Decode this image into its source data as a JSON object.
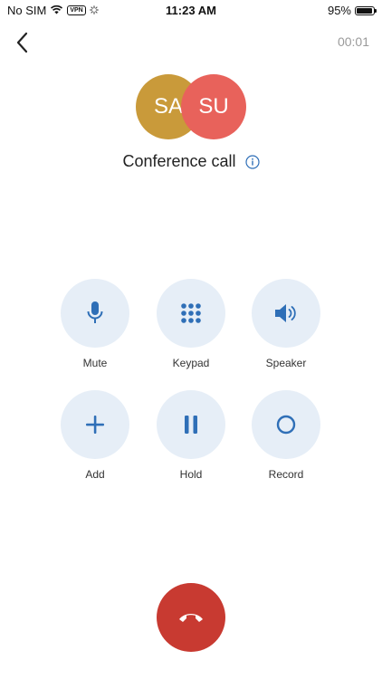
{
  "status_bar": {
    "carrier": "No SIM",
    "vpn": "VPN",
    "time": "11:23 AM",
    "battery_percent": "95%",
    "battery_level": 0.95,
    "icons": [
      "wifi-icon",
      "vpn-badge",
      "loading-icon",
      "battery-icon"
    ]
  },
  "header": {
    "back_icon": "chevron-left-icon",
    "timer": "00:01"
  },
  "participants": [
    {
      "initials": "SA",
      "color": "#c99a3a"
    },
    {
      "initials": "SU",
      "color": "#e8625b"
    }
  ],
  "call": {
    "title": "Conference call",
    "info_icon": "info-icon"
  },
  "actions": [
    {
      "label": "Mute",
      "icon": "microphone-icon"
    },
    {
      "label": "Keypad",
      "icon": "keypad-icon"
    },
    {
      "label": "Speaker",
      "icon": "speaker-icon"
    },
    {
      "label": "Add",
      "icon": "plus-icon"
    },
    {
      "label": "Hold",
      "icon": "pause-icon"
    },
    {
      "label": "Record",
      "icon": "record-icon"
    }
  ],
  "end_call": {
    "icon": "hang-up-icon",
    "color": "#c83a31"
  },
  "colors": {
    "accent": "#2f6fb7",
    "button_bg": "#e6eef7",
    "timer": "#9a9a9a"
  }
}
